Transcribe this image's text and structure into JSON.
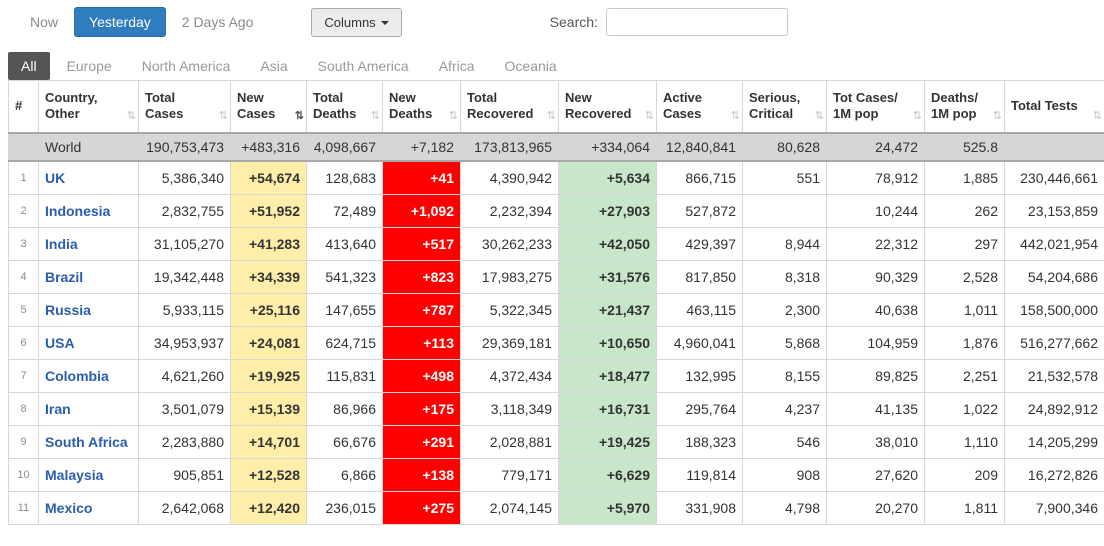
{
  "toolbar": {
    "now": "Now",
    "yesterday": "Yesterday",
    "two_days_ago": "2 Days Ago",
    "columns": "Columns",
    "search_label": "Search:",
    "search_value": ""
  },
  "tabs": [
    {
      "label": "All",
      "active": true
    },
    {
      "label": "Europe",
      "active": false
    },
    {
      "label": "North America",
      "active": false
    },
    {
      "label": "Asia",
      "active": false
    },
    {
      "label": "South America",
      "active": false
    },
    {
      "label": "Africa",
      "active": false
    },
    {
      "label": "Oceania",
      "active": false
    }
  ],
  "colors": {
    "new_cases_bg": "#FFEEAA",
    "new_deaths_bg": "#FF0000",
    "new_recovered_bg": "#C8E6C9",
    "world_row_bg": "#D6D6D6",
    "active_tab_bg": "#555555",
    "primary_button_bg": "#2F7CBE",
    "country_link_color": "#2A5DB0"
  },
  "table": {
    "sort_icon": "⇅",
    "sorted_column": "New Cases",
    "headers": [
      "#",
      "Country, Other",
      "Total Cases",
      "New Cases",
      "Total Deaths",
      "New Deaths",
      "Total Recovered",
      "New Recovered",
      "Active Cases",
      "Serious, Critical",
      "Tot Cases/ 1M pop",
      "Deaths/ 1M pop",
      "Total Tests"
    ],
    "world_row": {
      "rank": "",
      "country": "World",
      "values": [
        "190,753,473",
        "+483,316",
        "4,098,667",
        "+7,182",
        "173,813,965",
        "+334,064",
        "12,840,841",
        "80,628",
        "24,472",
        "525.8",
        ""
      ]
    },
    "rows": [
      {
        "rank": "1",
        "country": "UK",
        "values": [
          "5,386,340",
          "+54,674",
          "128,683",
          "+41",
          "4,390,942",
          "+5,634",
          "866,715",
          "551",
          "78,912",
          "1,885",
          "230,446,661"
        ]
      },
      {
        "rank": "2",
        "country": "Indonesia",
        "values": [
          "2,832,755",
          "+51,952",
          "72,489",
          "+1,092",
          "2,232,394",
          "+27,903",
          "527,872",
          "",
          "10,244",
          "262",
          "23,153,859"
        ]
      },
      {
        "rank": "3",
        "country": "India",
        "values": [
          "31,105,270",
          "+41,283",
          "413,640",
          "+517",
          "30,262,233",
          "+42,050",
          "429,397",
          "8,944",
          "22,312",
          "297",
          "442,021,954"
        ]
      },
      {
        "rank": "4",
        "country": "Brazil",
        "values": [
          "19,342,448",
          "+34,339",
          "541,323",
          "+823",
          "17,983,275",
          "+31,576",
          "817,850",
          "8,318",
          "90,329",
          "2,528",
          "54,204,686"
        ]
      },
      {
        "rank": "5",
        "country": "Russia",
        "values": [
          "5,933,115",
          "+25,116",
          "147,655",
          "+787",
          "5,322,345",
          "+21,437",
          "463,115",
          "2,300",
          "40,638",
          "1,011",
          "158,500,000"
        ]
      },
      {
        "rank": "6",
        "country": "USA",
        "values": [
          "34,953,937",
          "+24,081",
          "624,715",
          "+113",
          "29,369,181",
          "+10,650",
          "4,960,041",
          "5,868",
          "104,959",
          "1,876",
          "516,277,662"
        ]
      },
      {
        "rank": "7",
        "country": "Colombia",
        "values": [
          "4,621,260",
          "+19,925",
          "115,831",
          "+498",
          "4,372,434",
          "+18,477",
          "132,995",
          "8,155",
          "89,825",
          "2,251",
          "21,532,578"
        ]
      },
      {
        "rank": "8",
        "country": "Iran",
        "values": [
          "3,501,079",
          "+15,139",
          "86,966",
          "+175",
          "3,118,349",
          "+16,731",
          "295,764",
          "4,237",
          "41,135",
          "1,022",
          "24,892,912"
        ]
      },
      {
        "rank": "9",
        "country": "South Africa",
        "values": [
          "2,283,880",
          "+14,701",
          "66,676",
          "+291",
          "2,028,881",
          "+19,425",
          "188,323",
          "546",
          "38,010",
          "1,110",
          "14,205,299"
        ]
      },
      {
        "rank": "10",
        "country": "Malaysia",
        "values": [
          "905,851",
          "+12,528",
          "6,866",
          "+138",
          "779,171",
          "+6,629",
          "119,814",
          "908",
          "27,620",
          "209",
          "16,272,826"
        ]
      },
      {
        "rank": "11",
        "country": "Mexico",
        "values": [
          "2,642,068",
          "+12,420",
          "236,015",
          "+275",
          "2,074,145",
          "+5,970",
          "331,908",
          "4,798",
          "20,270",
          "1,811",
          "7,900,346"
        ]
      }
    ]
  }
}
